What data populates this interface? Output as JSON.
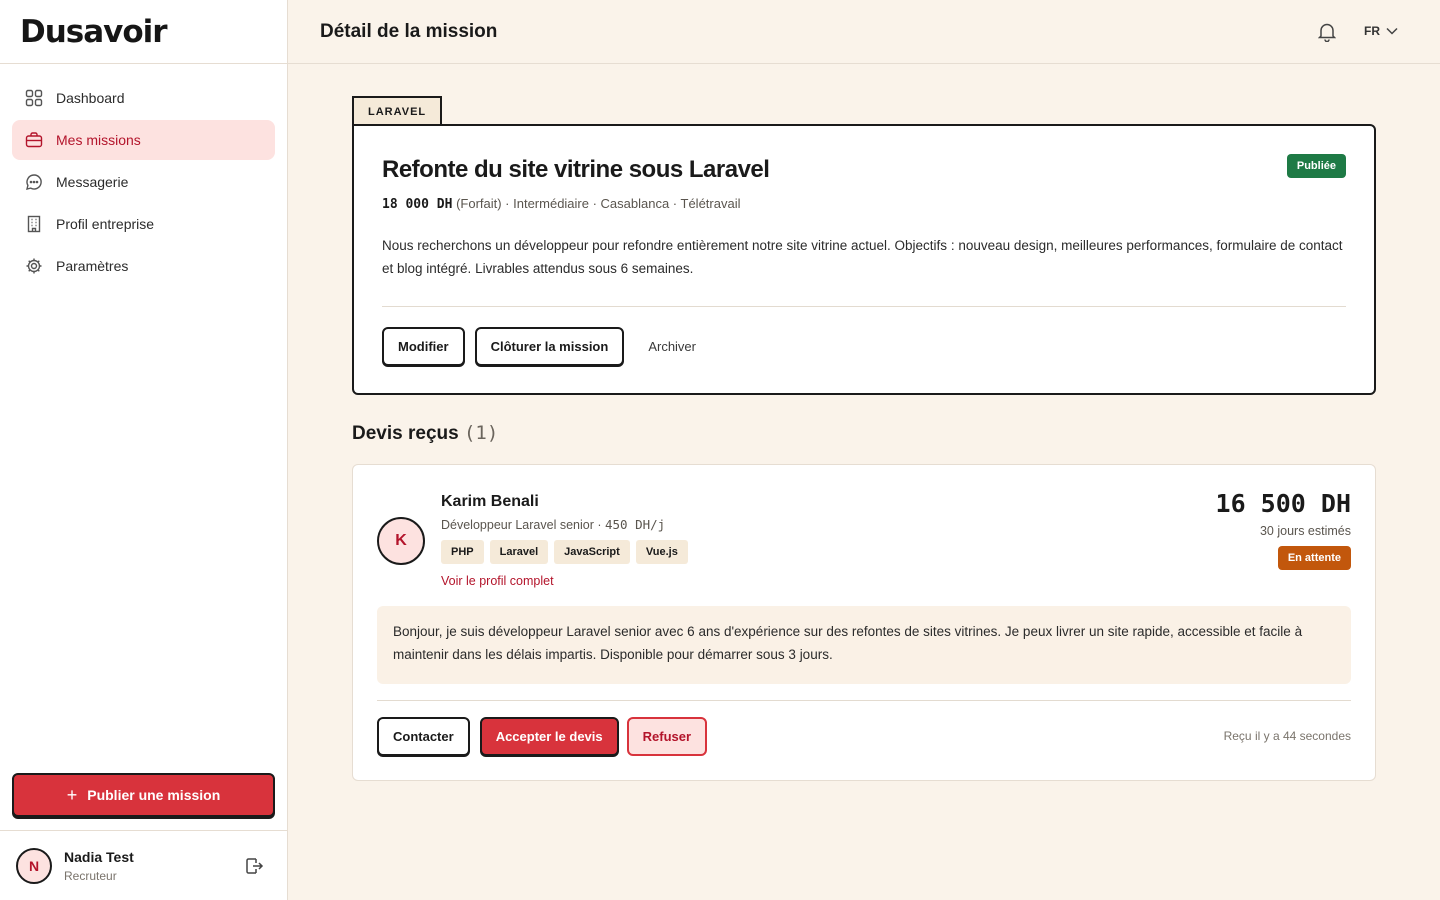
{
  "app": {
    "logo": "Dusavoir"
  },
  "sidebar": {
    "items": [
      {
        "label": "Dashboard",
        "icon": "dashboard-grid-icon"
      },
      {
        "label": "Mes missions",
        "icon": "briefcase-icon",
        "active": true
      },
      {
        "label": "Messagerie",
        "icon": "chat-bubble-icon"
      },
      {
        "label": "Profil entreprise",
        "icon": "building-icon"
      },
      {
        "label": "Paramètres",
        "icon": "gear-icon"
      }
    ],
    "publish_label": "Publier une mission",
    "user": {
      "initial": "N",
      "name": "Nadia Test",
      "role": "Recruteur"
    }
  },
  "header": {
    "title": "Détail de la mission",
    "lang": "FR"
  },
  "mission": {
    "tag": "LARAVEL",
    "title": "Refonte du site vitrine sous Laravel",
    "status": "Publiée",
    "price": "18 000 DH",
    "meta_rest": " (Forfait) · Intermédiaire · Casablanca · Télétravail",
    "description": "Nous recherchons un développeur pour refondre entièrement notre site vitrine actuel. Objectifs : nouveau design, meilleures performances, formulaire de contact et blog intégré. Livrables attendus sous 6 semaines.",
    "actions": {
      "edit": "Modifier",
      "close": "Clôturer la mission",
      "archive": "Archiver"
    }
  },
  "quotes": {
    "title": "Devis reçus",
    "count": "(1)",
    "items": [
      {
        "initial": "K",
        "name": "Karim Benali",
        "subtitle_prefix": "Développeur Laravel senior · ",
        "rate": "450 DH/j",
        "skills": [
          "PHP",
          "Laravel",
          "JavaScript",
          "Vue.js"
        ],
        "profile_link": "Voir le profil complet",
        "amount": "16 500 DH",
        "duration": "30 jours estimés",
        "status": "En attente",
        "message": "Bonjour, je suis développeur Laravel senior avec 6 ans d'expérience sur des refontes de sites vitrines. Je peux livrer un site rapide, accessible et facile à maintenir dans les délais impartis. Disponible pour démarrer sous 3 jours.",
        "actions": {
          "contact": "Contacter",
          "accept": "Accepter le devis",
          "refuse": "Refuser"
        },
        "received": "Reçu il y a 44 secondes"
      }
    ]
  },
  "colors": {
    "accent": "#d8333c",
    "published": "#1e7a45",
    "pending": "#c2570c",
    "background": "#faf3ea"
  }
}
